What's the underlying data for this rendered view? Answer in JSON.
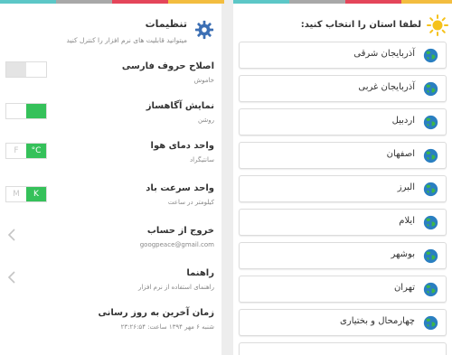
{
  "colors": {
    "stripe": [
      "#5cc7c7",
      "#9f9f9f",
      "#e4455a",
      "#f3bd3f"
    ],
    "toggle_on": "#35c15a",
    "accent_gear": "#3c6fb4",
    "sun": "#f5c21b",
    "globe_green": "#3cb54a",
    "globe_blue": "#2a7fc1"
  },
  "settings": {
    "title": "تنظیمات",
    "subtitle": "میتوانید قابلیت های نرم افزار را کنترل کنید",
    "items": [
      {
        "title": "اصلاح حروف فارسی",
        "sub": "خاموش",
        "control": "toggle",
        "state": "off"
      },
      {
        "title": "نمایش آگاهساز",
        "sub": "روشن",
        "control": "toggle",
        "state": "on"
      },
      {
        "title": "واحد دمای هوا",
        "sub": "سانتیگراد",
        "control": "segment",
        "options": [
          "F",
          "°C"
        ],
        "selected": "°C"
      },
      {
        "title": "واحد سرعت باد",
        "sub": "کیلومتر در ساعت",
        "control": "segment",
        "options": [
          "M",
          "K"
        ],
        "selected": "K"
      },
      {
        "title": "خروج از حساب",
        "sub": "googpeace@gmail.com",
        "control": "chevron"
      },
      {
        "title": "راهنما",
        "sub": "راهنمای استفاده از نرم افزار",
        "control": "chevron"
      },
      {
        "title": "زمان آخرین به روز رسانی",
        "sub": "شنبه ۶ مهر ۱۳۹۴ ساعت: ۲۳:۲۶:۵۴",
        "control": "none"
      }
    ]
  },
  "provinces": {
    "title": "لطفا استان را انتخاب کنید:",
    "items": [
      "آذربایجان شرقی",
      "آذربایجان غربی",
      "اردبیل",
      "اصفهان",
      "البرز",
      "ایلام",
      "بوشهر",
      "تهران",
      "چهارمحال و بختیاری"
    ]
  }
}
